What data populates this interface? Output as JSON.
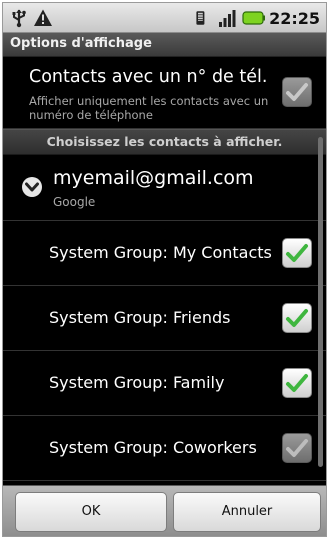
{
  "status_bar": {
    "time": "22:25",
    "left_icons": [
      "usb-icon",
      "warning-icon"
    ],
    "right_icons": [
      "vibrate-icon",
      "signal-icon",
      "battery-icon"
    ]
  },
  "title": "Options d'affichage",
  "phone_only_pref": {
    "title": "Contacts avec un n° de tél.",
    "summary": "Afficher uniquement les contacts avec un numéro de téléphone",
    "checked": true,
    "enabled": false
  },
  "section_header": "Choisissez les contacts à afficher.",
  "account": {
    "name": "myemail@gmail.com",
    "type": "Google",
    "expanded": true
  },
  "groups": [
    {
      "label": "System Group: My Contacts",
      "checked": true,
      "enabled": true
    },
    {
      "label": "System Group: Friends",
      "checked": true,
      "enabled": true
    },
    {
      "label": "System Group: Family",
      "checked": true,
      "enabled": true
    },
    {
      "label": "System Group: Coworkers",
      "checked": true,
      "enabled": false
    }
  ],
  "buttons": {
    "ok": "OK",
    "cancel": "Annuler"
  },
  "colors": {
    "check_green": "#3fb63f",
    "check_disabled": "#bdbdbd",
    "battery_green": "#7ed321"
  }
}
